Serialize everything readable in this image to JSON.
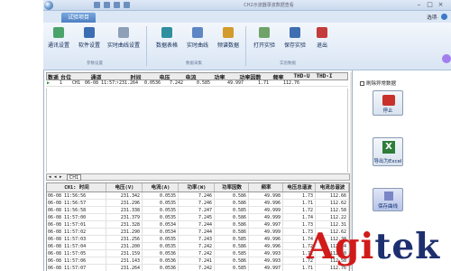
{
  "window": {
    "title": "CH2示波器录波数据查看"
  },
  "tabs": {
    "active": "试验项目",
    "options": "选项·"
  },
  "ribbon": {
    "buttons": [
      {
        "label": "通讯设置"
      },
      {
        "label": "软件设置"
      },
      {
        "label": "实时曲线设置"
      },
      {
        "label": "数据表格"
      },
      {
        "label": "实时曲线"
      },
      {
        "label": "频谱数据"
      },
      {
        "label": "打开实验"
      },
      {
        "label": "保存实验"
      },
      {
        "label": "退出"
      }
    ],
    "groups": [
      "参数设置",
      "数据采集",
      "实验数据"
    ]
  },
  "summary_table": {
    "headers": [
      "数遥",
      "台位",
      "通道",
      "时间",
      "电压",
      "电流",
      "功率",
      "功率因数",
      "频率",
      "THD-U",
      "THD-I"
    ],
    "row": [
      "▶",
      "1",
      "CH1",
      "06-08 11:57:08",
      "231.264",
      "0.0536",
      "7.242",
      "0.585",
      "49.997",
      "1.71",
      "112.76"
    ]
  },
  "tabstrip": {
    "tab": "CH1"
  },
  "detail_table": {
    "headers": [
      "CH1: 时间",
      "电压(V)",
      "电流(A)",
      "功率(W)",
      "功率因数",
      "频率",
      "电压总谐波",
      "电流总谐波"
    ],
    "rows": [
      [
        "06-08 11:56:56",
        "231.342",
        "0.0535",
        "7.246",
        "0.586",
        "49.998",
        "1.73",
        "112.66"
      ],
      [
        "06-08 11:56:57",
        "231.296",
        "0.0535",
        "7.246",
        "0.586",
        "49.996",
        "1.71",
        "112.62"
      ],
      [
        "06-08 11:56:58",
        "231.338",
        "0.0535",
        "7.247",
        "0.585",
        "49.999",
        "1.72",
        "112.58"
      ],
      [
        "06-08 11:57:00",
        "231.379",
        "0.0535",
        "7.245",
        "0.586",
        "49.999",
        "1.74",
        "112.22"
      ],
      [
        "06-08 11:57:01",
        "231.328",
        "0.0534",
        "7.244",
        "0.586",
        "49.997",
        "1.73",
        "112.31"
      ],
      [
        "06-08 11:57:02",
        "231.290",
        "0.0534",
        "7.244",
        "0.586",
        "49.999",
        "1.73",
        "112.62"
      ],
      [
        "06-08 11:57:03",
        "231.256",
        "0.0535",
        "7.243",
        "0.585",
        "49.996",
        "1.74",
        "112.38"
      ],
      [
        "06-08 11:57:04",
        "231.200",
        "0.0535",
        "7.242",
        "0.586",
        "49.996",
        "1.72",
        "112.44"
      ],
      [
        "06-08 11:57:05",
        "231.159",
        "0.0536",
        "7.242",
        "0.585",
        "49.993",
        "1.72",
        "112.20"
      ],
      [
        "06-08 11:57:06",
        "231.143",
        "0.0536",
        "7.241",
        "0.586",
        "49.993",
        "1.72",
        "112.58"
      ],
      [
        "06-08 11:57:07",
        "231.264",
        "0.0536",
        "7.242",
        "0.585",
        "49.997",
        "1.71",
        "112.76"
      ]
    ]
  },
  "right_panel": {
    "checkbox_label": "刷除异常数据",
    "stop_label": "停止",
    "excel_label": "导出为Excel",
    "save_curve_label": "保存曲线"
  },
  "logo": {
    "brand_main": "Agi",
    "brand_accent": "tek"
  }
}
